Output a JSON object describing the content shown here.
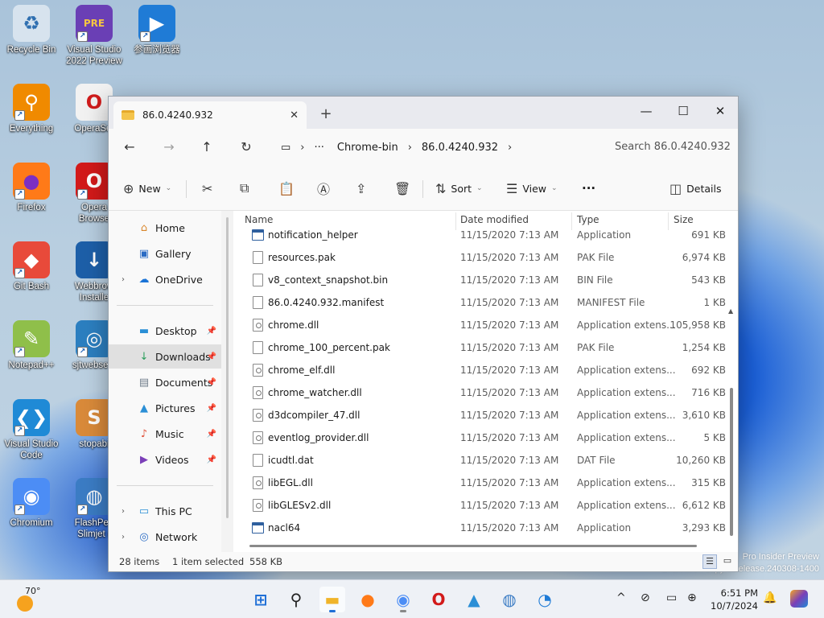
{
  "desktop": {
    "icons": [
      {
        "label": "Recycle Bin",
        "glyph": "♻",
        "color": "#d7e3ee",
        "fg": "#2f6fb0",
        "shortcut": false
      },
      {
        "label": "Visual Studio\n2022 Preview",
        "glyph": "PRE",
        "color": "#6a3fb5",
        "fg": "#f5c542",
        "shortcut": true
      },
      {
        "label": "参画浏览器",
        "glyph": "▶",
        "color": "#1f7bd6",
        "fg": "#ffffff",
        "shortcut": true
      },
      {
        "label": "Everything",
        "glyph": "⚲",
        "color": "#f08a00",
        "fg": "#ffffff",
        "shortcut": true
      },
      {
        "label": "OperaSet",
        "glyph": "O",
        "color": "#f2f2f2",
        "fg": "#d01c1c",
        "shortcut": false
      },
      {
        "label": "Firefox",
        "glyph": "●",
        "color": "#ff7a18",
        "fg": "#7c2fc2",
        "shortcut": true
      },
      {
        "label": "Opera\nBrowse",
        "glyph": "O",
        "color": "#d21a1a",
        "fg": "#ffffff",
        "shortcut": true
      },
      {
        "label": "Git Bash",
        "glyph": "◆",
        "color": "#e84a3a",
        "fg": "#ffffff",
        "shortcut": true
      },
      {
        "label": "Webbrow\nInstalle",
        "glyph": "↓",
        "color": "#1d5fa8",
        "fg": "#ffffff",
        "shortcut": false
      },
      {
        "label": "Notepad++",
        "glyph": "✎",
        "color": "#8fbf4a",
        "fg": "#ffffff",
        "shortcut": true
      },
      {
        "label": "sjtwebsetu",
        "glyph": "◎",
        "color": "#2c7fc0",
        "fg": "#ffffff",
        "shortcut": true
      },
      {
        "label": "Visual Studio\nCode",
        "glyph": "❮❯",
        "color": "#1f8ad6",
        "fg": "#ffffff",
        "shortcut": true
      },
      {
        "label": "stopabi",
        "glyph": "S",
        "color": "#d98a3a",
        "fg": "#ffffff",
        "shortcut": false
      },
      {
        "label": "Chromium",
        "glyph": "◉",
        "color": "#4c8df5",
        "fg": "#ffffff",
        "shortcut": true
      },
      {
        "label": "FlashPea\nSlimjet (",
        "glyph": "◍",
        "color": "#3b7cc4",
        "fg": "#ffffff",
        "shortcut": true
      }
    ],
    "watermark": {
      "line1": "Pro Insider Preview",
      "line2": "Evaluation copy. ... elease.240308-1400"
    }
  },
  "window": {
    "tab_title": "86.0.4240.932",
    "tab_close": "✕",
    "new_tab": "+",
    "controls": {
      "minimize": "—",
      "maximize": "☐",
      "close": "✕"
    },
    "nav": {
      "back": "←",
      "forward": "→",
      "up": "↑",
      "refresh": "↻",
      "monitor": "▭",
      "chevron": "›",
      "more": "···"
    },
    "breadcrumb": [
      "Chrome-bin",
      "86.0.4240.932"
    ],
    "search_placeholder": "Search 86.0.4240.932",
    "command_bar": {
      "new_label": "New",
      "sort_label": "Sort",
      "view_label": "View",
      "more": "···",
      "details_label": "Details"
    },
    "nav_pane": {
      "quick": [
        {
          "label": "Home",
          "glyph": "⌂",
          "color": "#d9862b"
        },
        {
          "label": "Gallery",
          "glyph": "▣",
          "color": "#2b6cc4"
        },
        {
          "label": "OneDrive",
          "glyph": "☁",
          "color": "#1a73d6"
        }
      ],
      "pinned": [
        {
          "label": "Desktop",
          "glyph": "▬",
          "color": "#2b8fd6"
        },
        {
          "label": "Downloads",
          "glyph": "↓",
          "color": "#2a9d5b"
        },
        {
          "label": "Documents",
          "glyph": "▤",
          "color": "#6f7d8a"
        },
        {
          "label": "Pictures",
          "glyph": "▲",
          "color": "#2b8fd6"
        },
        {
          "label": "Music",
          "glyph": "♪",
          "color": "#e0533c"
        },
        {
          "label": "Videos",
          "glyph": "▶",
          "color": "#7b3fb8"
        }
      ],
      "devices": [
        {
          "label": "This PC",
          "glyph": "▭",
          "color": "#2b8fd6"
        },
        {
          "label": "Network",
          "glyph": "◎",
          "color": "#2b6cc4"
        }
      ],
      "pin_glyph": "📌",
      "expand_glyph": "›"
    },
    "columns": {
      "name": "Name",
      "date": "Date modified",
      "type": "Type",
      "size": "Size"
    },
    "files": [
      {
        "name": "notification_helper",
        "date": "11/15/2020 7:13 AM",
        "type": "Application",
        "size": "691 KB",
        "kind": "app"
      },
      {
        "name": "resources.pak",
        "date": "11/15/2020 7:13 AM",
        "type": "PAK File",
        "size": "6,974 KB",
        "kind": "file"
      },
      {
        "name": "v8_context_snapshot.bin",
        "date": "11/15/2020 7:13 AM",
        "type": "BIN File",
        "size": "543 KB",
        "kind": "file"
      },
      {
        "name": "86.0.4240.932.manifest",
        "date": "11/15/2020 7:13 AM",
        "type": "MANIFEST File",
        "size": "1 KB",
        "kind": "file"
      },
      {
        "name": "chrome.dll",
        "date": "11/15/2020 7:13 AM",
        "type": "Application extens...",
        "size": "105,958 KB",
        "kind": "dll"
      },
      {
        "name": "chrome_100_percent.pak",
        "date": "11/15/2020 7:13 AM",
        "type": "PAK File",
        "size": "1,254 KB",
        "kind": "file"
      },
      {
        "name": "chrome_elf.dll",
        "date": "11/15/2020 7:13 AM",
        "type": "Application extens...",
        "size": "692 KB",
        "kind": "dll"
      },
      {
        "name": "chrome_watcher.dll",
        "date": "11/15/2020 7:13 AM",
        "type": "Application extens...",
        "size": "716 KB",
        "kind": "dll"
      },
      {
        "name": "d3dcompiler_47.dll",
        "date": "11/15/2020 7:13 AM",
        "type": "Application extens...",
        "size": "3,610 KB",
        "kind": "dll"
      },
      {
        "name": "eventlog_provider.dll",
        "date": "11/15/2020 7:13 AM",
        "type": "Application extens...",
        "size": "5 KB",
        "kind": "dll"
      },
      {
        "name": "icudtl.dat",
        "date": "11/15/2020 7:13 AM",
        "type": "DAT File",
        "size": "10,260 KB",
        "kind": "file"
      },
      {
        "name": "libEGL.dll",
        "date": "11/15/2020 7:13 AM",
        "type": "Application extens...",
        "size": "315 KB",
        "kind": "dll"
      },
      {
        "name": "libGLESv2.dll",
        "date": "11/15/2020 7:13 AM",
        "type": "Application extens...",
        "size": "6,612 KB",
        "kind": "dll"
      },
      {
        "name": "nacl64",
        "date": "11/15/2020 7:13 AM",
        "type": "Application",
        "size": "3,293 KB",
        "kind": "app"
      }
    ],
    "status": {
      "items": "28 items",
      "selected": "1 item selected",
      "size": "558 KB"
    }
  },
  "taskbar": {
    "weather_temp": "70°",
    "apps": [
      {
        "name": "start-button",
        "glyph": "⊞",
        "color": "#1f6fd6",
        "active": false,
        "running": false
      },
      {
        "name": "search-button",
        "glyph": "⚲",
        "color": "#222222",
        "active": false,
        "running": false
      },
      {
        "name": "file-explorer",
        "glyph": "▬",
        "color": "#f0b429",
        "active": true,
        "running": true
      },
      {
        "name": "firefox",
        "glyph": "●",
        "color": "#ff7a18",
        "active": false,
        "running": false
      },
      {
        "name": "chromium",
        "glyph": "◉",
        "color": "#4c8df5",
        "active": false,
        "running": true
      },
      {
        "name": "opera",
        "glyph": "O",
        "color": "#d21a1a",
        "active": false,
        "running": false
      },
      {
        "name": "photos",
        "glyph": "▲",
        "color": "#2b8fd6",
        "active": false,
        "running": false
      },
      {
        "name": "globe-browser",
        "glyph": "◍",
        "color": "#3b7cc4",
        "active": false,
        "running": false
      },
      {
        "name": "edge-like-browser",
        "glyph": "◔",
        "color": "#1f7bd6",
        "active": false,
        "running": false
      }
    ],
    "tray": {
      "chevron": "^",
      "network": "⊘",
      "display": "▭",
      "language": "⊕",
      "notify": "🔔"
    },
    "time": "6:51 PM",
    "date": "10/7/2024"
  }
}
